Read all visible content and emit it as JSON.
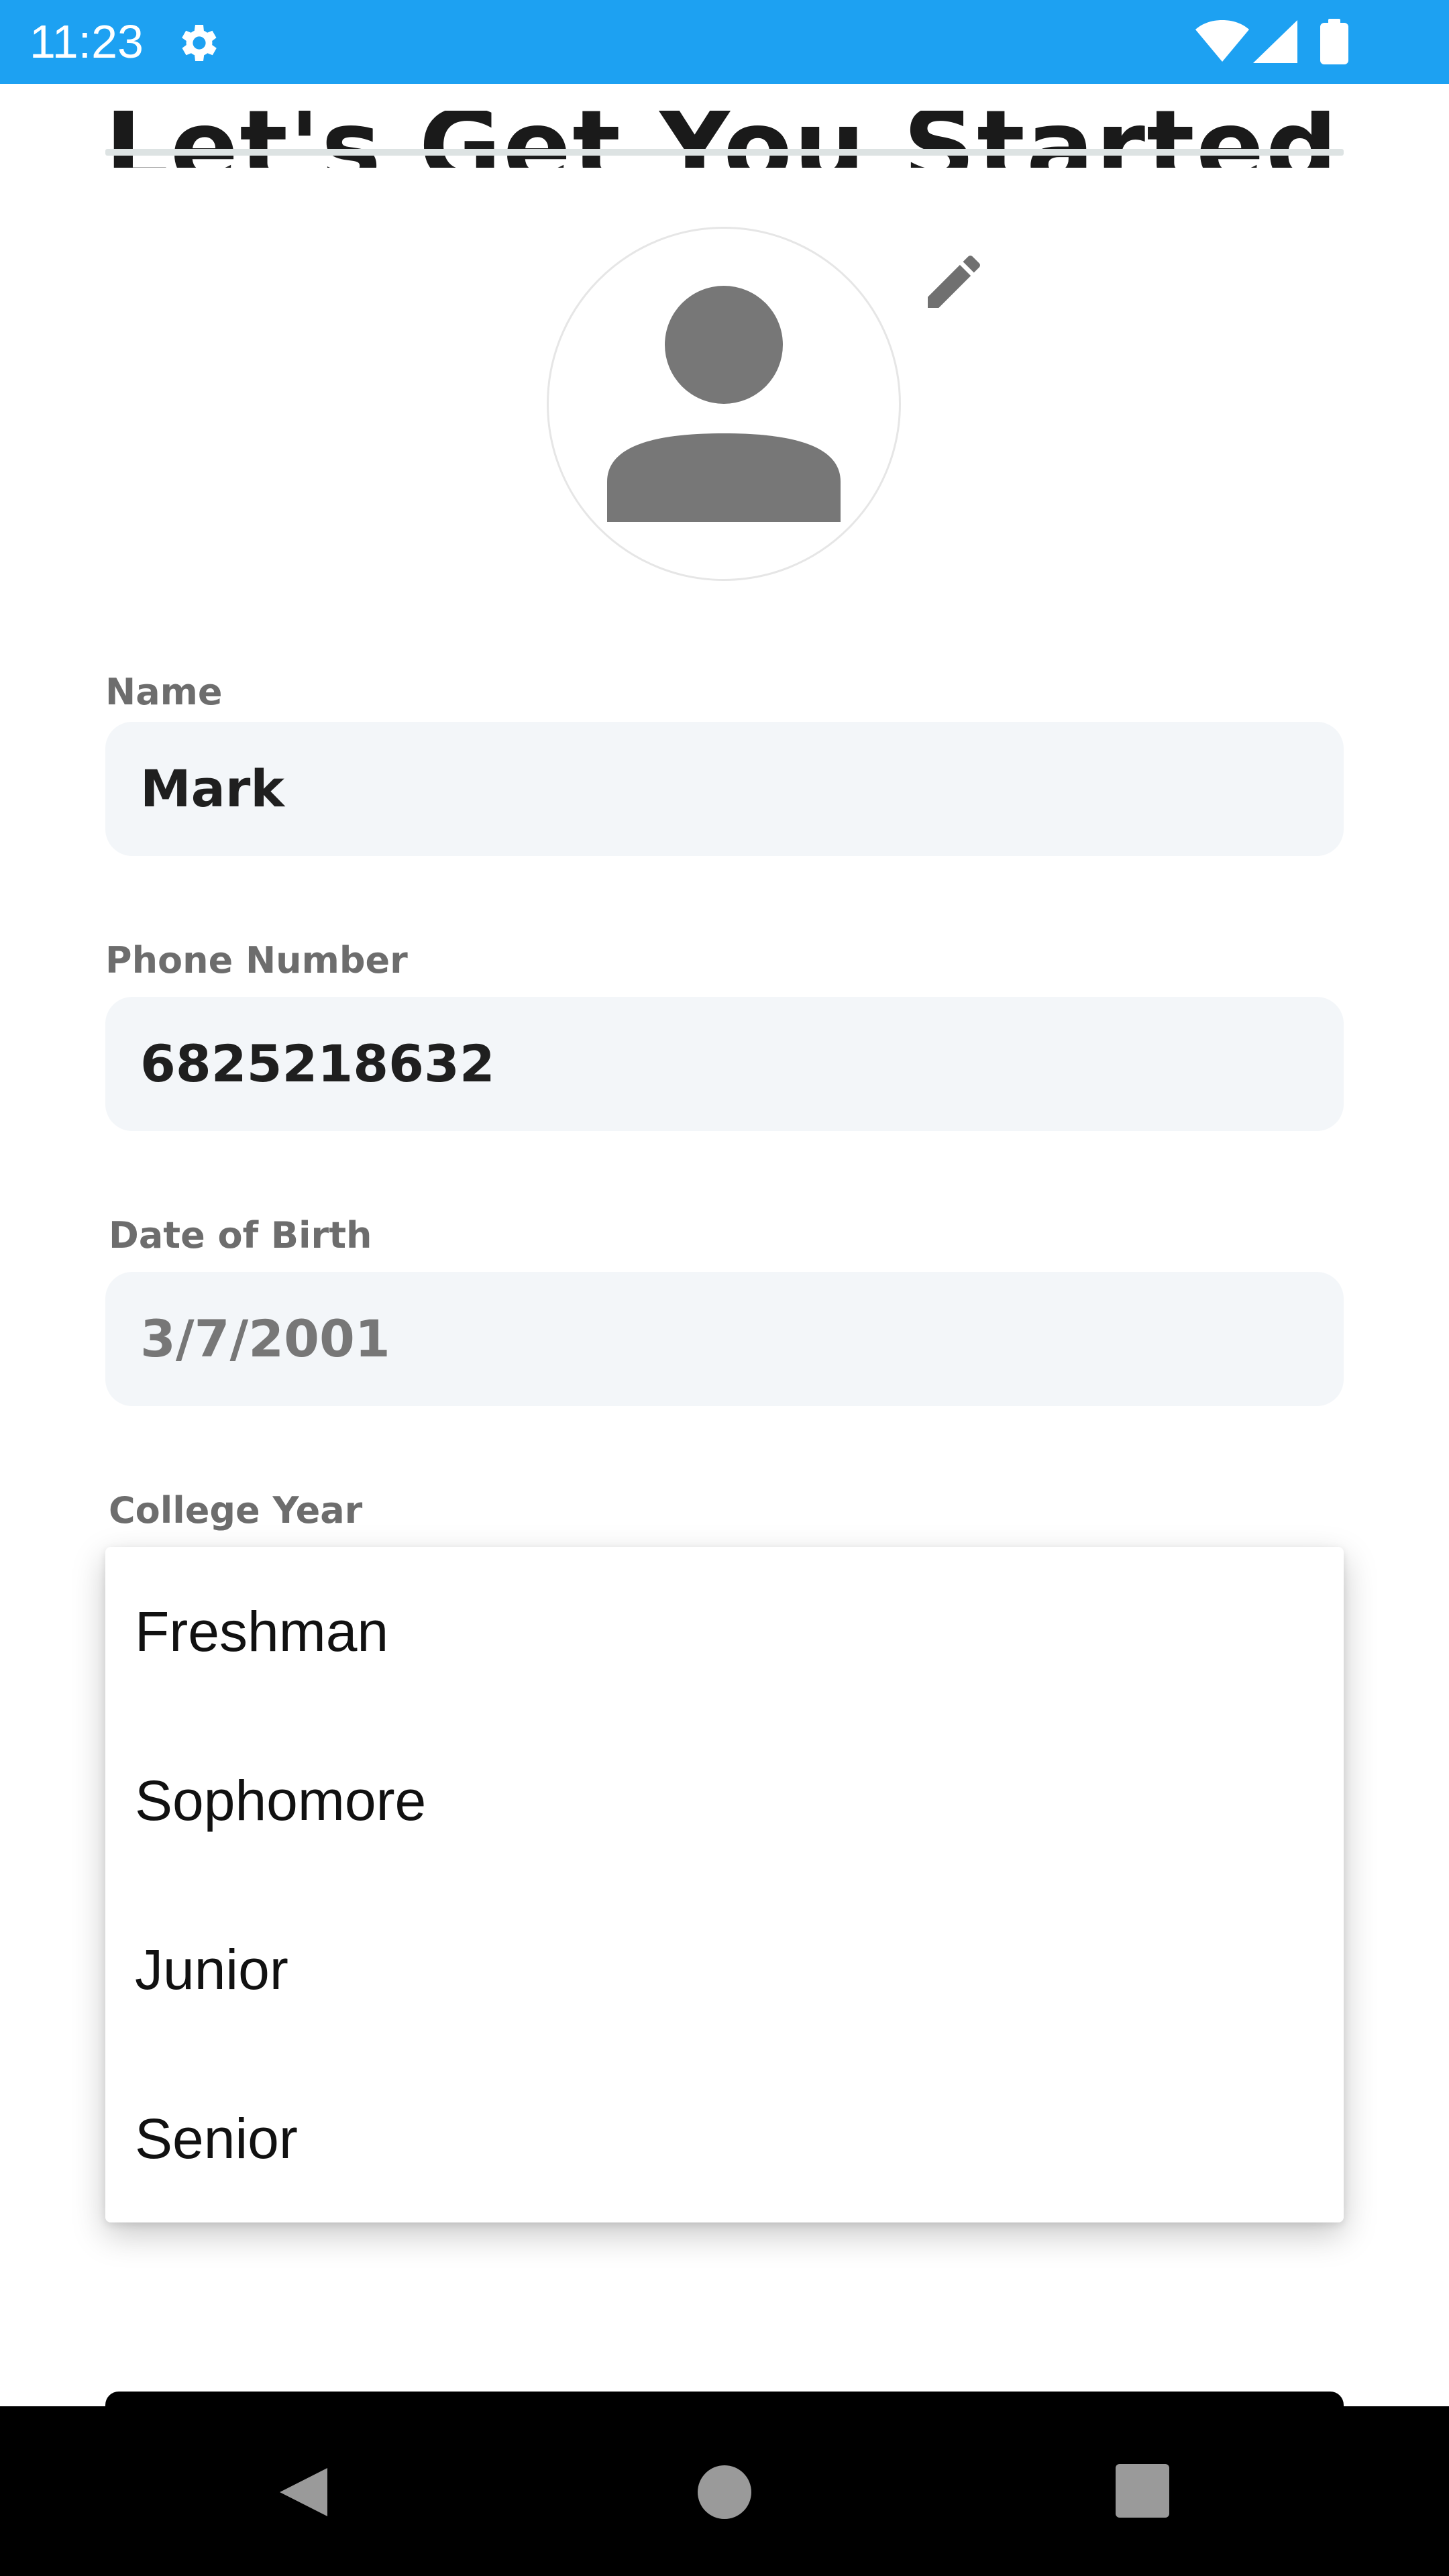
{
  "status_bar": {
    "time": "11:23",
    "icons": [
      "gear-icon",
      "wifi-icon",
      "signal-icon",
      "battery-icon"
    ],
    "color": "#1da1f2"
  },
  "page": {
    "title": "Let's Get You Started"
  },
  "avatar": {
    "icon": "person-icon",
    "edit_icon": "pencil-icon"
  },
  "form": {
    "name": {
      "label": "Name",
      "value": "Mark"
    },
    "phone": {
      "label": "Phone Number",
      "value": "6825218632"
    },
    "dob": {
      "label": "Date of Birth",
      "value": "3/7/2001"
    },
    "college_year": {
      "label": "College Year",
      "options": [
        "Freshman",
        "Sophomore",
        "Junior",
        "Senior"
      ]
    }
  },
  "nav_bar": {
    "icons": [
      "back-icon",
      "home-icon",
      "recents-icon"
    ]
  }
}
